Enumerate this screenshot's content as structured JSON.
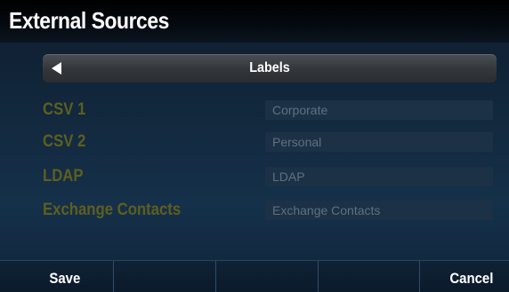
{
  "header": {
    "title": "External Sources"
  },
  "nav": {
    "label": "Labels",
    "back_icon": "left-triangle-icon"
  },
  "rows": [
    {
      "label": "CSV 1",
      "value": "Corporate"
    },
    {
      "label": "CSV 2",
      "value": "Personal"
    },
    {
      "label": "LDAP",
      "value": "LDAP"
    },
    {
      "label": "Exchange Contacts",
      "value": "Exchange Contacts"
    }
  ],
  "softkeys": [
    {
      "label": "Save"
    },
    {
      "label": ""
    },
    {
      "label": ""
    },
    {
      "label": ""
    },
    {
      "label": "Cancel"
    }
  ],
  "colors": {
    "label_text": "#5e5f1e",
    "field_text": "#5f7083",
    "background": "#132a40"
  }
}
